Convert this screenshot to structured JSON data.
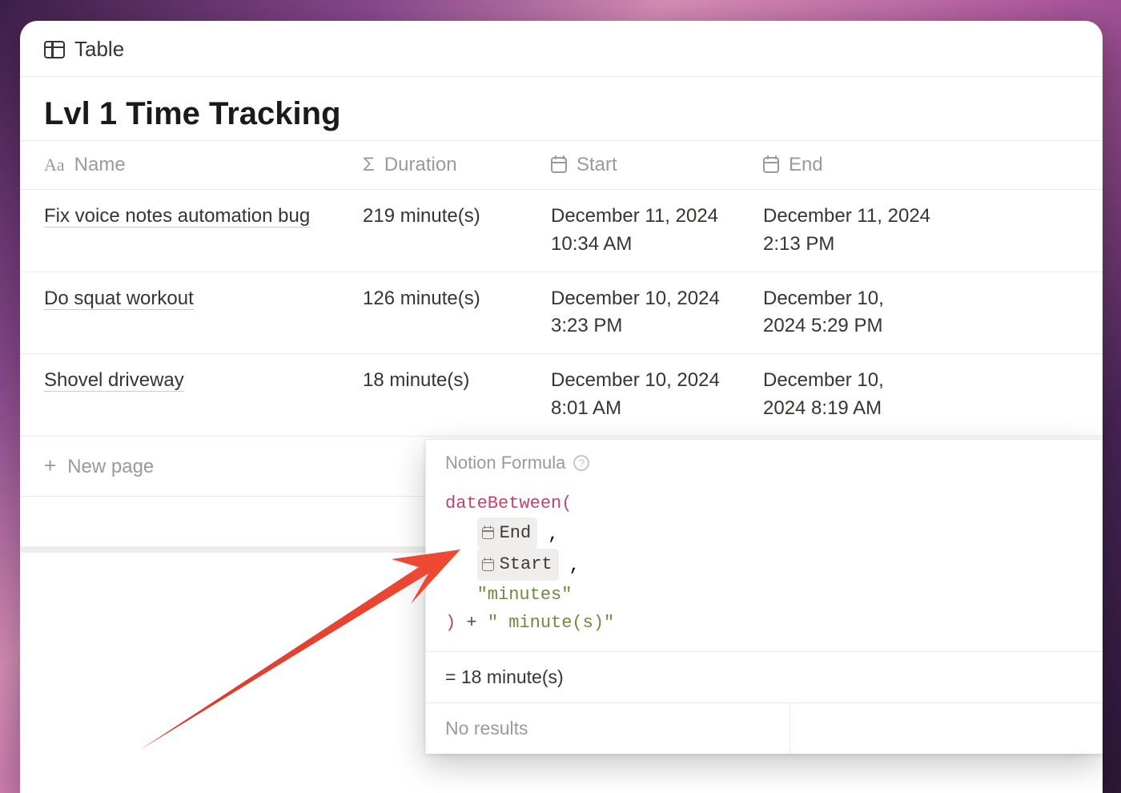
{
  "tab_label": "Table",
  "database_title": "Lvl 1 Time Tracking",
  "columns": {
    "name": "Name",
    "duration": "Duration",
    "start": "Start",
    "end": "End"
  },
  "rows": [
    {
      "name": "Fix voice notes automation bug",
      "duration": "219 minute(s)",
      "start": "December 11, 2024 10:34 AM",
      "end": "December 11, 2024 2:13 PM"
    },
    {
      "name": "Do squat workout",
      "duration": "126 minute(s)",
      "start": "December 10, 2024 3:23 PM",
      "end": "December 10, 2024 5:29 PM"
    },
    {
      "name": "Shovel driveway",
      "duration": "18 minute(s)",
      "start": "December 10, 2024 8:01 AM",
      "end": "December 10, 2024 8:19 AM"
    }
  ],
  "new_page_label": "New page",
  "formula": {
    "header": "Notion Formula",
    "fn": "dateBetween",
    "arg1_chip": "End",
    "arg2_chip": "Start",
    "arg3_string": "\"minutes\"",
    "concat_op": "+",
    "concat_string": "\" minute(s)\"",
    "result_prefix": "=",
    "result_value": "18 minute(s)",
    "no_results": "No results"
  }
}
